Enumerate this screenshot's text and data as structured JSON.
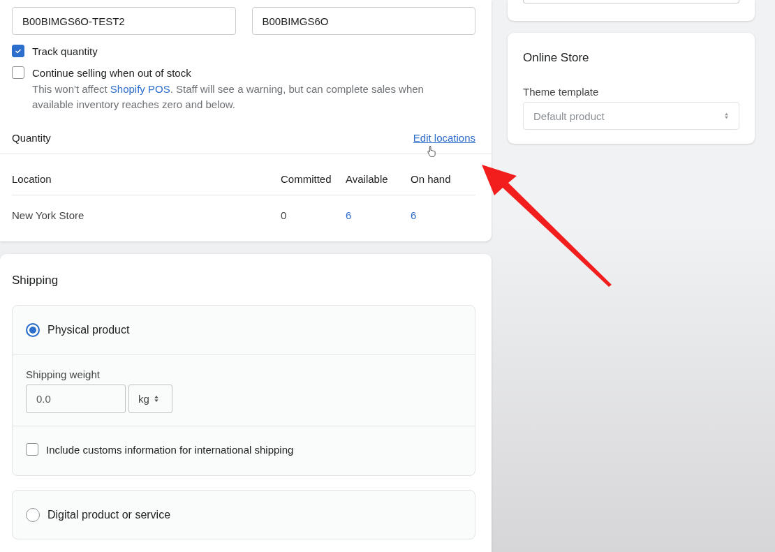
{
  "inventory": {
    "sku": {
      "value": "B00BIMGS6O-TEST2"
    },
    "barcode": {
      "value": "B00BIMGS6O"
    },
    "options": [
      {
        "label": "Track quantity",
        "checked": true
      },
      {
        "label": "Continue selling when out of stock",
        "checked": false,
        "help_before": "This won't affect ",
        "help_link": "Shopify POS",
        "help_after": ". Staff will see a warning, but can complete sales when available inventory reaches zero and below."
      }
    ],
    "quantity_title": "Quantity",
    "edit_link": "Edit locations",
    "table": {
      "columns": [
        "Location",
        "Committed",
        "Available",
        "On hand"
      ],
      "rows": [
        [
          "New York Store",
          "0",
          "6",
          "6"
        ]
      ]
    }
  },
  "shipping": {
    "title": "Shipping",
    "options": [
      {
        "label": "Physical product",
        "selected": true,
        "weight_label": "Shipping weight",
        "weight_value": "0.0",
        "unit": "kg",
        "customs": {
          "label": "Include customs information for international shipping",
          "checked": false
        }
      },
      {
        "label": "Digital product or service",
        "selected": false
      }
    ]
  },
  "online_store": {
    "title": "Online Store",
    "template_label": "Theme template",
    "template_value": "Default product"
  }
}
